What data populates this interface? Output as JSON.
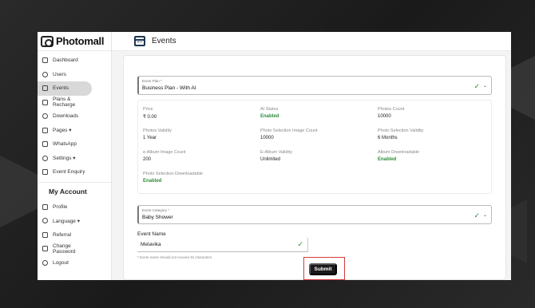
{
  "app": {
    "name": "Photomall"
  },
  "sidebar": {
    "items": [
      {
        "label": "Dashboard",
        "icon": "dashboard-icon"
      },
      {
        "label": "Users",
        "icon": "user-icon"
      },
      {
        "label": "Events",
        "icon": "calendar-icon",
        "active": true
      },
      {
        "label": "Plans & Recharge",
        "icon": "wallet-icon"
      },
      {
        "label": "Downloads",
        "icon": "download-icon"
      },
      {
        "label": "Pages ▾",
        "icon": "pages-icon"
      },
      {
        "label": "WhatsApp",
        "icon": "whatsapp-icon"
      },
      {
        "label": "Settings ▾",
        "icon": "gear-icon"
      },
      {
        "label": "Event Enquiry",
        "icon": "enquiry-icon"
      }
    ],
    "account_title": "My Account",
    "account_items": [
      {
        "label": "Profile",
        "icon": "profile-icon"
      },
      {
        "label": "Language ▾",
        "icon": "language-icon"
      },
      {
        "label": "Referral",
        "icon": "referral-icon"
      },
      {
        "label": "Change Password",
        "icon": "key-icon"
      },
      {
        "label": "Logout",
        "icon": "logout-icon"
      }
    ]
  },
  "header": {
    "title": "Events"
  },
  "form": {
    "event_plan": {
      "label": "Event Plan *",
      "value": "Business Plan - With AI"
    },
    "details": [
      {
        "label": "Price",
        "value": "₹ 0.00",
        "green": false
      },
      {
        "label": "AI Status",
        "value": "Enabled",
        "green": true
      },
      {
        "label": "Photos Count",
        "value": "10000",
        "green": false
      },
      {
        "label": "Photos Validity",
        "value": "1 Year",
        "green": false
      },
      {
        "label": "Photo Selection Image Count",
        "value": "10000",
        "green": false
      },
      {
        "label": "Photo Selection Validity",
        "value": "6 Months",
        "green": false
      },
      {
        "label": "e-Album Image Count",
        "value": "200",
        "green": false
      },
      {
        "label": "E-Album Validity",
        "value": "Unlimited",
        "green": false
      },
      {
        "label": "Album Downloadable",
        "value": "Enabled",
        "green": true
      },
      {
        "label": "Photo Selection Downloadable",
        "value": "Enabled",
        "green": true
      }
    ],
    "event_category": {
      "label": "Event Category *",
      "value": "Baby Shower"
    },
    "event_name": {
      "label": "Event Name",
      "value": "Melavika",
      "hint": "* Event name should not exceed 45 characters"
    },
    "submit_label": "Submit"
  },
  "colors": {
    "accent": "#2e8b3a",
    "highlight": "#d43a3a",
    "button": "#1a1a1a"
  }
}
